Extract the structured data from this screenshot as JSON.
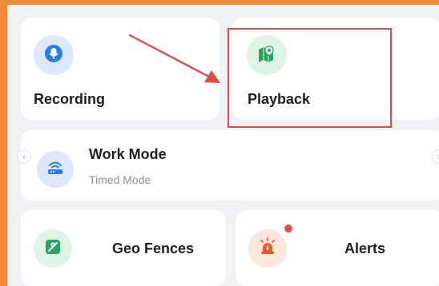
{
  "tiles": {
    "recording": {
      "label": "Recording",
      "icon": "microphone-icon",
      "icon_bg": "#dde9fb",
      "icon_color": "#2b7ce9"
    },
    "playback": {
      "label": "Playback",
      "icon": "map-pin-icon",
      "icon_bg": "#dff3e6",
      "icon_color": "#25a55e"
    },
    "work_mode": {
      "label": "Work Mode",
      "value": "Timed Mode",
      "icon": "router-icon",
      "icon_bg": "#dde9fb",
      "icon_color": "#2b7ce9"
    },
    "geo_fences": {
      "label": "Geo Fences",
      "icon": "geo-fence-icon",
      "icon_bg": "#dff3e6",
      "icon_color": "#25a55e"
    },
    "alerts": {
      "label": "Alerts",
      "icon": "siren-icon",
      "icon_bg": "#fde6dc",
      "icon_color": "#f05a2a",
      "has_unread": true
    }
  },
  "colors": {
    "frame_border": "#f08a3a",
    "highlight": "#e24a4a",
    "badge": "#f04848"
  }
}
